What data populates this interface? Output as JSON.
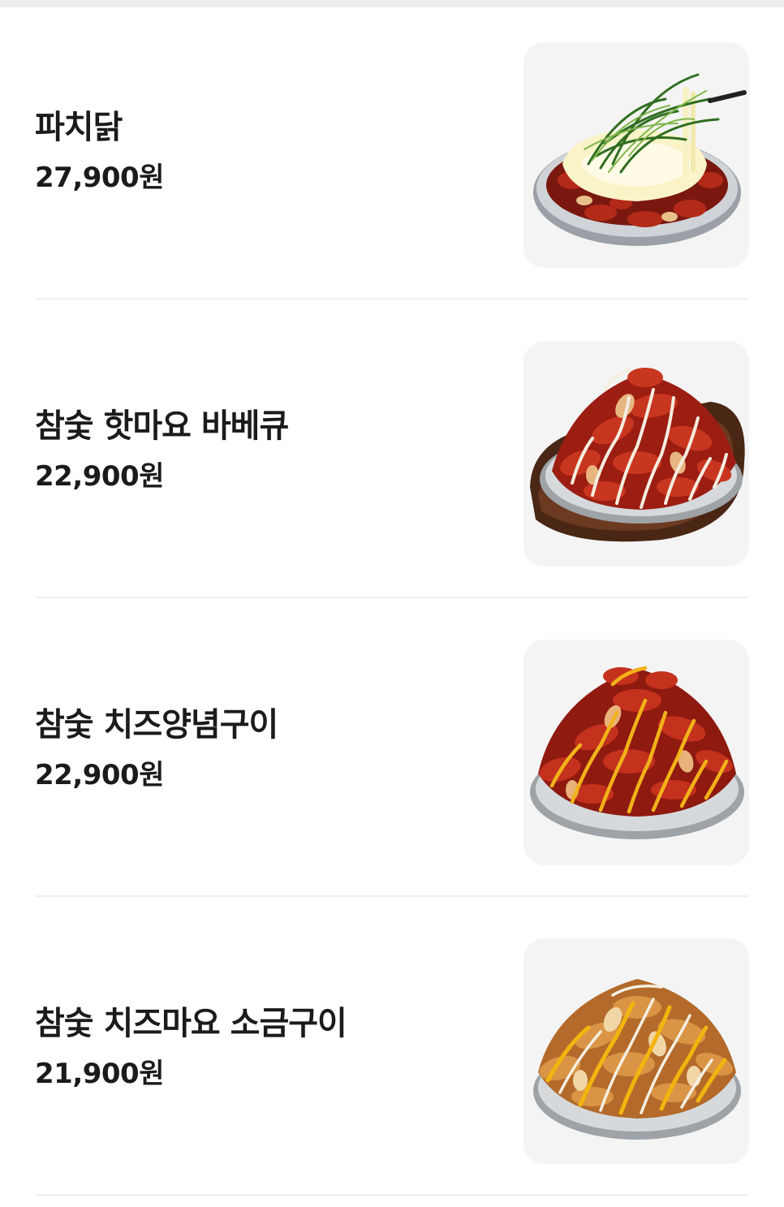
{
  "menu": {
    "items": [
      {
        "name": "파치닭",
        "price": "27,900원",
        "image_icon": "green-onion-cheese-chicken-dish"
      },
      {
        "name": "참숯 핫마요 바베큐",
        "price": "22,900원",
        "image_icon": "hot-mayo-bbq-chicken-dish"
      },
      {
        "name": "참숯 치즈양념구이",
        "price": "22,900원",
        "image_icon": "cheese-yangnyeom-chicken-dish"
      },
      {
        "name": "참숯 치즈마요 소금구이",
        "price": "21,900원",
        "image_icon": "cheese-mayo-salt-chicken-dish"
      }
    ]
  },
  "colors": {
    "divider": "#f0f0f0",
    "thumb_bg": "#f4f4f4",
    "text": "#1b1b1b"
  }
}
